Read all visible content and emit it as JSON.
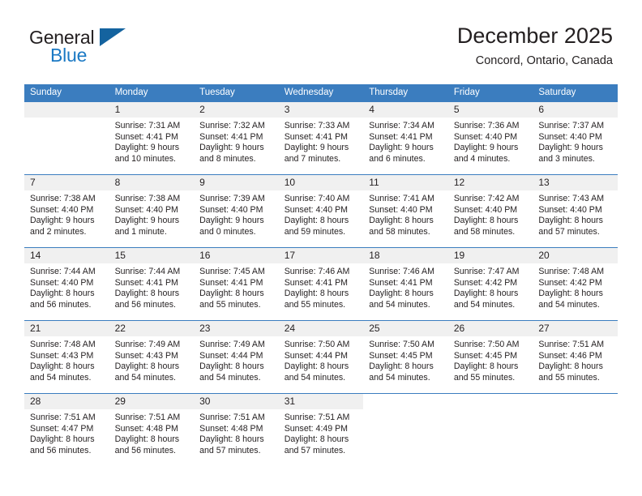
{
  "brand": {
    "name_part1": "General",
    "name_part2": "Blue",
    "logo_icon": "triangle-logo-icon",
    "accent_color": "#1b79c4"
  },
  "header": {
    "title": "December 2025",
    "subtitle": "Concord, Ontario, Canada"
  },
  "theme": {
    "header_blue": "#3b7dbf",
    "band_gray": "#f0f0f0",
    "text": "#231f20"
  },
  "weekdays": [
    "Sunday",
    "Monday",
    "Tuesday",
    "Wednesday",
    "Thursday",
    "Friday",
    "Saturday"
  ],
  "weeks": [
    [
      {
        "day": "",
        "lines": []
      },
      {
        "day": "1",
        "lines": [
          "Sunrise: 7:31 AM",
          "Sunset: 4:41 PM",
          "Daylight: 9 hours",
          "and 10 minutes."
        ]
      },
      {
        "day": "2",
        "lines": [
          "Sunrise: 7:32 AM",
          "Sunset: 4:41 PM",
          "Daylight: 9 hours",
          "and 8 minutes."
        ]
      },
      {
        "day": "3",
        "lines": [
          "Sunrise: 7:33 AM",
          "Sunset: 4:41 PM",
          "Daylight: 9 hours",
          "and 7 minutes."
        ]
      },
      {
        "day": "4",
        "lines": [
          "Sunrise: 7:34 AM",
          "Sunset: 4:41 PM",
          "Daylight: 9 hours",
          "and 6 minutes."
        ]
      },
      {
        "day": "5",
        "lines": [
          "Sunrise: 7:36 AM",
          "Sunset: 4:40 PM",
          "Daylight: 9 hours",
          "and 4 minutes."
        ]
      },
      {
        "day": "6",
        "lines": [
          "Sunrise: 7:37 AM",
          "Sunset: 4:40 PM",
          "Daylight: 9 hours",
          "and 3 minutes."
        ]
      }
    ],
    [
      {
        "day": "7",
        "lines": [
          "Sunrise: 7:38 AM",
          "Sunset: 4:40 PM",
          "Daylight: 9 hours",
          "and 2 minutes."
        ]
      },
      {
        "day": "8",
        "lines": [
          "Sunrise: 7:38 AM",
          "Sunset: 4:40 PM",
          "Daylight: 9 hours",
          "and 1 minute."
        ]
      },
      {
        "day": "9",
        "lines": [
          "Sunrise: 7:39 AM",
          "Sunset: 4:40 PM",
          "Daylight: 9 hours",
          "and 0 minutes."
        ]
      },
      {
        "day": "10",
        "lines": [
          "Sunrise: 7:40 AM",
          "Sunset: 4:40 PM",
          "Daylight: 8 hours",
          "and 59 minutes."
        ]
      },
      {
        "day": "11",
        "lines": [
          "Sunrise: 7:41 AM",
          "Sunset: 4:40 PM",
          "Daylight: 8 hours",
          "and 58 minutes."
        ]
      },
      {
        "day": "12",
        "lines": [
          "Sunrise: 7:42 AM",
          "Sunset: 4:40 PM",
          "Daylight: 8 hours",
          "and 58 minutes."
        ]
      },
      {
        "day": "13",
        "lines": [
          "Sunrise: 7:43 AM",
          "Sunset: 4:40 PM",
          "Daylight: 8 hours",
          "and 57 minutes."
        ]
      }
    ],
    [
      {
        "day": "14",
        "lines": [
          "Sunrise: 7:44 AM",
          "Sunset: 4:40 PM",
          "Daylight: 8 hours",
          "and 56 minutes."
        ]
      },
      {
        "day": "15",
        "lines": [
          "Sunrise: 7:44 AM",
          "Sunset: 4:41 PM",
          "Daylight: 8 hours",
          "and 56 minutes."
        ]
      },
      {
        "day": "16",
        "lines": [
          "Sunrise: 7:45 AM",
          "Sunset: 4:41 PM",
          "Daylight: 8 hours",
          "and 55 minutes."
        ]
      },
      {
        "day": "17",
        "lines": [
          "Sunrise: 7:46 AM",
          "Sunset: 4:41 PM",
          "Daylight: 8 hours",
          "and 55 minutes."
        ]
      },
      {
        "day": "18",
        "lines": [
          "Sunrise: 7:46 AM",
          "Sunset: 4:41 PM",
          "Daylight: 8 hours",
          "and 54 minutes."
        ]
      },
      {
        "day": "19",
        "lines": [
          "Sunrise: 7:47 AM",
          "Sunset: 4:42 PM",
          "Daylight: 8 hours",
          "and 54 minutes."
        ]
      },
      {
        "day": "20",
        "lines": [
          "Sunrise: 7:48 AM",
          "Sunset: 4:42 PM",
          "Daylight: 8 hours",
          "and 54 minutes."
        ]
      }
    ],
    [
      {
        "day": "21",
        "lines": [
          "Sunrise: 7:48 AM",
          "Sunset: 4:43 PM",
          "Daylight: 8 hours",
          "and 54 minutes."
        ]
      },
      {
        "day": "22",
        "lines": [
          "Sunrise: 7:49 AM",
          "Sunset: 4:43 PM",
          "Daylight: 8 hours",
          "and 54 minutes."
        ]
      },
      {
        "day": "23",
        "lines": [
          "Sunrise: 7:49 AM",
          "Sunset: 4:44 PM",
          "Daylight: 8 hours",
          "and 54 minutes."
        ]
      },
      {
        "day": "24",
        "lines": [
          "Sunrise: 7:50 AM",
          "Sunset: 4:44 PM",
          "Daylight: 8 hours",
          "and 54 minutes."
        ]
      },
      {
        "day": "25",
        "lines": [
          "Sunrise: 7:50 AM",
          "Sunset: 4:45 PM",
          "Daylight: 8 hours",
          "and 54 minutes."
        ]
      },
      {
        "day": "26",
        "lines": [
          "Sunrise: 7:50 AM",
          "Sunset: 4:45 PM",
          "Daylight: 8 hours",
          "and 55 minutes."
        ]
      },
      {
        "day": "27",
        "lines": [
          "Sunrise: 7:51 AM",
          "Sunset: 4:46 PM",
          "Daylight: 8 hours",
          "and 55 minutes."
        ]
      }
    ],
    [
      {
        "day": "28",
        "lines": [
          "Sunrise: 7:51 AM",
          "Sunset: 4:47 PM",
          "Daylight: 8 hours",
          "and 56 minutes."
        ]
      },
      {
        "day": "29",
        "lines": [
          "Sunrise: 7:51 AM",
          "Sunset: 4:48 PM",
          "Daylight: 8 hours",
          "and 56 minutes."
        ]
      },
      {
        "day": "30",
        "lines": [
          "Sunrise: 7:51 AM",
          "Sunset: 4:48 PM",
          "Daylight: 8 hours",
          "and 57 minutes."
        ]
      },
      {
        "day": "31",
        "lines": [
          "Sunrise: 7:51 AM",
          "Sunset: 4:49 PM",
          "Daylight: 8 hours",
          "and 57 minutes."
        ]
      },
      {
        "day": "",
        "lines": []
      },
      {
        "day": "",
        "lines": []
      },
      {
        "day": "",
        "lines": []
      }
    ]
  ]
}
